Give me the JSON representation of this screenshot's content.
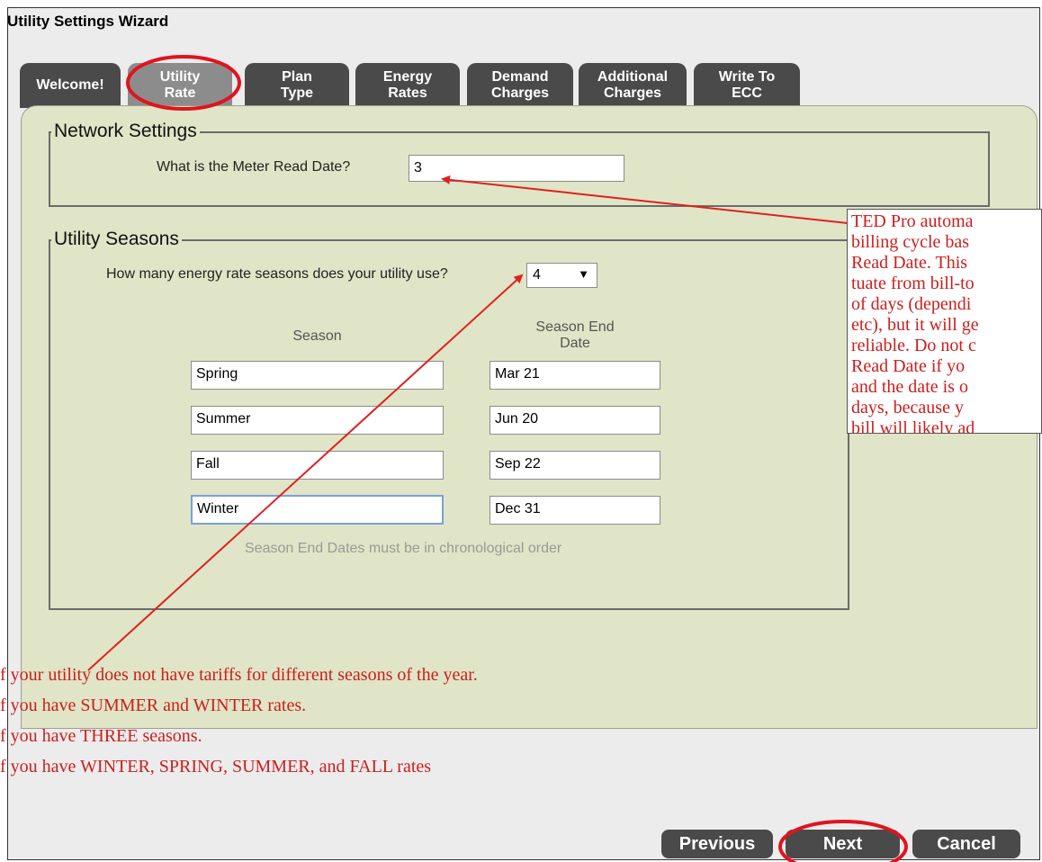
{
  "window": {
    "title": "Utility Settings Wizard"
  },
  "tabs": [
    {
      "line1": "Welcome!",
      "line2": ""
    },
    {
      "line1": "Utility",
      "line2": "Rate"
    },
    {
      "line1": "Plan",
      "line2": "Type"
    },
    {
      "line1": "Energy",
      "line2": "Rates"
    },
    {
      "line1": "Demand",
      "line2": "Charges"
    },
    {
      "line1": "Additional",
      "line2": "Charges"
    },
    {
      "line1": "Write To",
      "line2": "ECC"
    }
  ],
  "network": {
    "legend": "Network Settings",
    "question": "What is the Meter Read Date?",
    "meter_read_date": "3"
  },
  "seasons": {
    "legend": "Utility Seasons",
    "question": "How many energy rate seasons does your utility use?",
    "count": "4",
    "col_season": "Season",
    "col_end_line1": "Season End",
    "col_end_line2": "Date",
    "rows": [
      {
        "name": "Spring",
        "end": "Mar 21"
      },
      {
        "name": "Summer",
        "end": "Jun 20"
      },
      {
        "name": "Fall",
        "end": "Sep 22"
      },
      {
        "name": "Winter",
        "end": "Dec 31"
      }
    ],
    "hint": "Season End Dates must be in chronological order"
  },
  "buttons": {
    "previous": "Previous",
    "next": "Next",
    "cancel": "Cancel"
  },
  "callout_lines": [
    "TED Pro automa",
    "billing cycle bas",
    "Read Date.  This",
    "tuate from bill-to",
    "of days (dependi",
    "etc), but it will ge",
    "reliable.  Do not c",
    "Read Date if yo",
    "and the date is o",
    "days,  because  y",
    "bill will likely ad"
  ],
  "notes": [
    "f your utility does not have tariffs for different seasons of the year.",
    "f you have SUMMER and WINTER rates.",
    "f you have THREE seasons.",
    "f you have WINTER, SPRING, SUMMER, and FALL rates"
  ],
  "colors": {
    "annotation": "#cc1e1e",
    "panel": "#dfe5c6",
    "tab": "#4a4a4a",
    "tab_active": "#8c8c8c"
  }
}
